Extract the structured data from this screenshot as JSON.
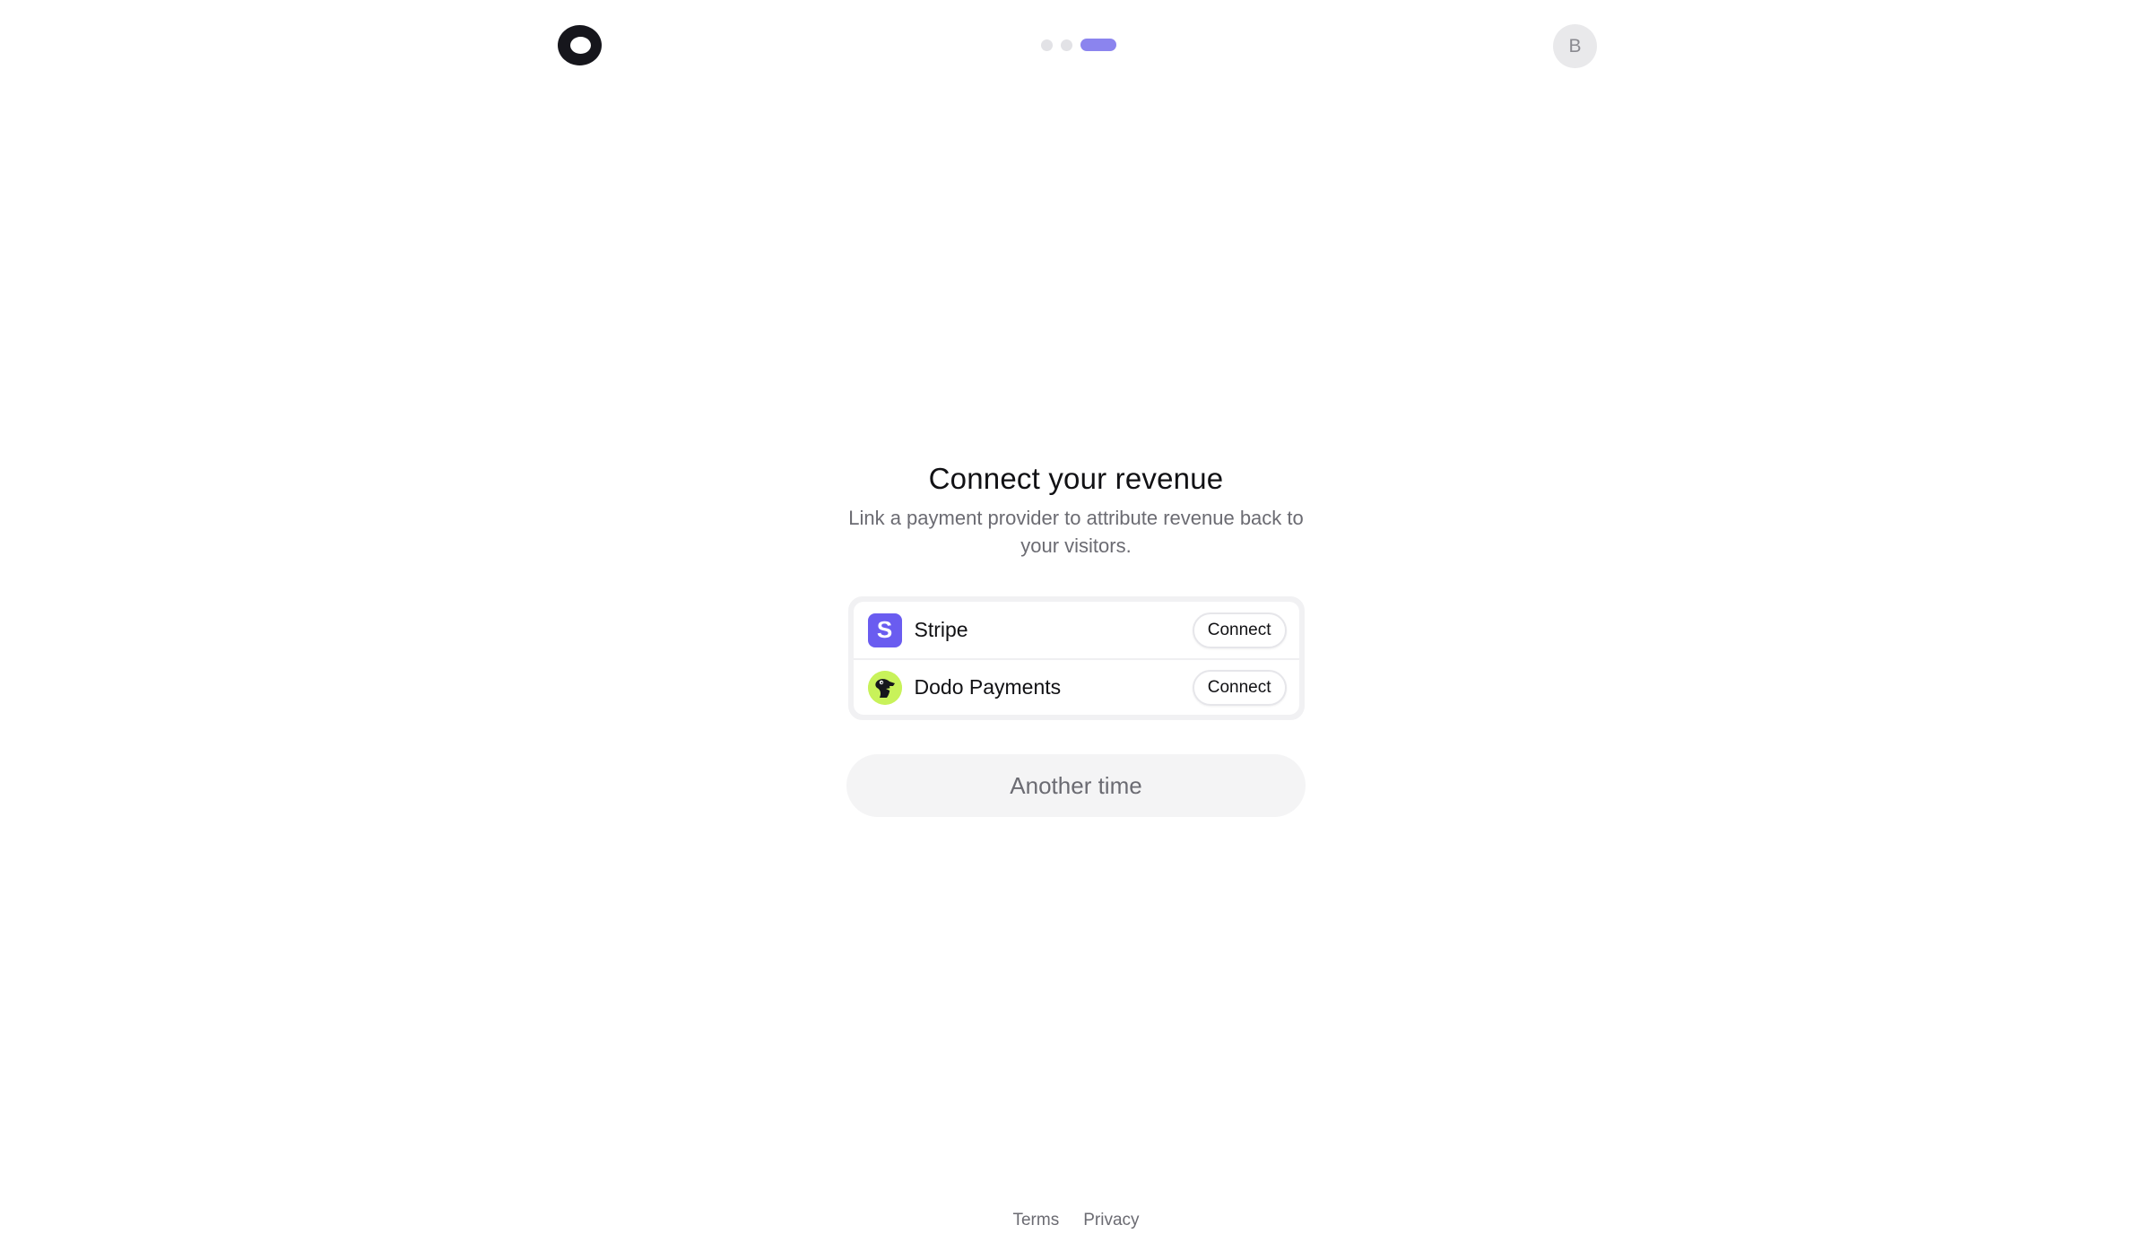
{
  "header": {
    "logo_icon": "ring-logo-icon",
    "steps": {
      "total": 3,
      "current": 3
    },
    "avatar_initial": "B"
  },
  "main": {
    "title": "Connect your revenue",
    "subtitle": "Link a payment provider to attribute revenue back to your visitors.",
    "providers": [
      {
        "name": "Stripe",
        "icon": "stripe-logo-icon",
        "icon_letter": "S",
        "action": "Connect"
      },
      {
        "name": "Dodo Payments",
        "icon": "dodo-logo-icon",
        "action": "Connect"
      }
    ],
    "skip_label": "Another time"
  },
  "footer": {
    "terms": "Terms",
    "privacy": "Privacy"
  },
  "colors": {
    "accent": "#8b84ee",
    "stripe": "#6a5cf0",
    "dodo": "#c8f25a",
    "text": "#111114",
    "muted": "#6b6b72"
  }
}
